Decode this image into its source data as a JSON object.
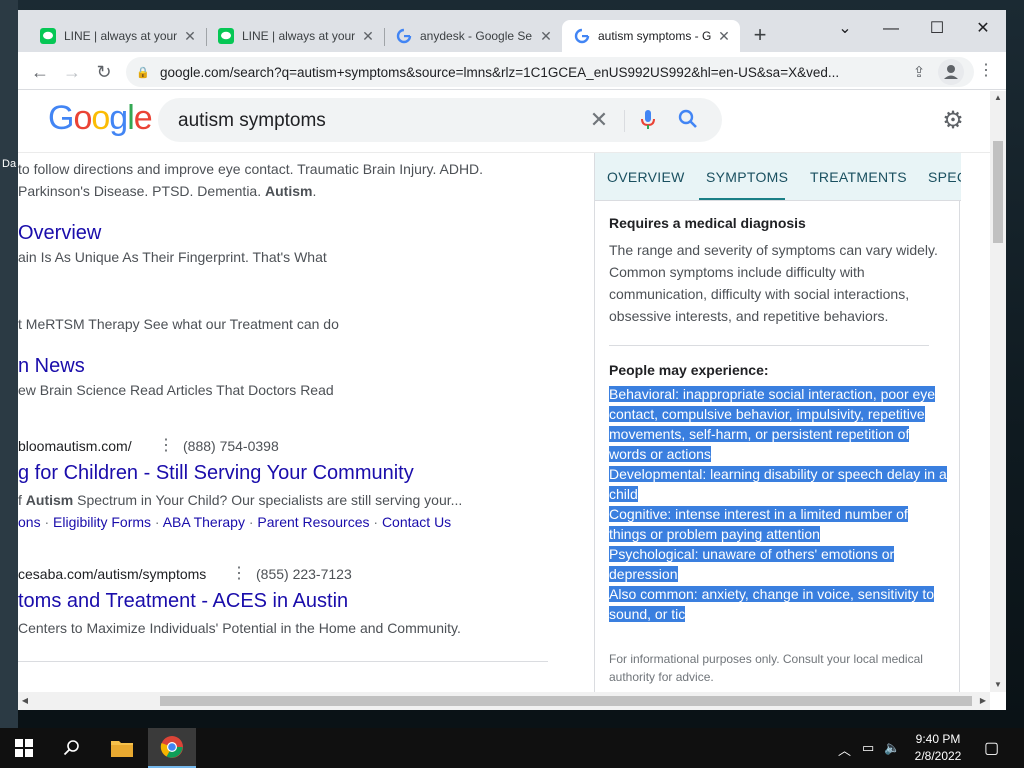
{
  "desktop": {
    "left_label": "Da"
  },
  "tabs": [
    {
      "title": "LINE | always at your",
      "icon": "line-icon"
    },
    {
      "title": "LINE | always at your",
      "icon": "line-icon"
    },
    {
      "title": "anydesk - Google Se",
      "icon": "google-icon"
    },
    {
      "title": "autism symptoms - G",
      "icon": "google-icon"
    }
  ],
  "toolbar": {
    "url": "google.com/search?q=autism+symptoms&source=lmns&rlz=1C1GCEA_enUS992US992&hl=en-US&sa=X&ved..."
  },
  "search": {
    "query": "autism symptoms"
  },
  "results": {
    "r0_line1": "to follow directions and improve eye contact. Traumatic Brain Injury. ADHD.",
    "r0_line2a": "Parkinson's Disease. PTSD. Dementia. ",
    "r0_line2b": "Autism",
    "r0_line2c": ".",
    "r1_title": "Overview",
    "r1_snip": "ain Is As Unique As Their Fingerprint. That's What",
    "r1b_snip": "t MeRTSM Therapy See what our Treatment can do",
    "r2_title": "n News",
    "r2_snip": "ew Brain Science Read Articles That Doctors Read",
    "r3_url": "bloomautism.com/",
    "r3_phone": "(888) 754-0398",
    "r3_title": "g for Children - Still Serving Your Community",
    "r3_snip_a": "f ",
    "r3_snip_b": "Autism",
    "r3_snip_c": " Spectrum in Your Child? Our specialists are still serving your...",
    "r3_links": [
      "ons",
      "Eligibility Forms",
      "ABA Therapy",
      "Parent Resources",
      "Contact Us"
    ],
    "r4_url": "cesaba.com/autism/symptoms",
    "r4_phone": "(855) 223-7123",
    "r4_title": "toms and Treatment - ACES in Austin",
    "r4_snip": "Centers to Maximize Individuals' Potential in the Home and Community."
  },
  "panel": {
    "tabs": [
      "OVERVIEW",
      "SYMPTOMS",
      "TREATMENTS",
      "SPEC"
    ],
    "active_tab": "SYMPTOMS",
    "heading": "Requires a medical diagnosis",
    "summary": "The range and severity of symptoms can vary widely. Common symptoms include difficulty with communication, difficulty with social interactions, obsessive interests, and repetitive behaviors.",
    "people_heading": "People may experience:",
    "lines": [
      "Behavioral: inappropriate social interaction, poor eye",
      "contact, compulsive behavior, impulsivity, repetitive",
      "movements, self-harm, or persistent repetition of",
      "words or actions",
      "Developmental: learning disability or speech delay in a",
      "child",
      "Cognitive: intense interest in a limited number of",
      "things or problem paying attention",
      "Psychological: unaware of others' emotions or",
      "depression",
      "Also common: anxiety, change in voice, sensitivity to",
      "sound, or tic"
    ],
    "note": "For informational purposes only. Consult your local medical authority for advice.",
    "selection_color": "#3a7fdf"
  },
  "taskbar": {
    "time": "9:40 PM",
    "date": "2/8/2022"
  }
}
